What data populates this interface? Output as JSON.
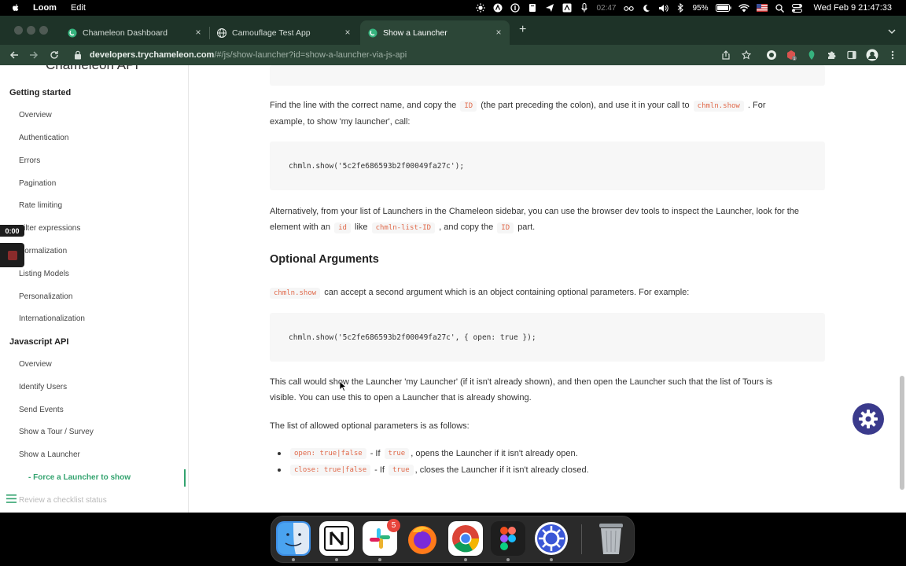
{
  "menubar": {
    "app_name": "Loom",
    "menu_edit": "Edit",
    "timer": "02:47",
    "battery": "95%",
    "clock": "Wed Feb 9  21:47:33"
  },
  "tabs": [
    {
      "label": "Chameleon Dashboard"
    },
    {
      "label": "Camouflage Test App"
    },
    {
      "label": "Show a Launcher"
    }
  ],
  "url": {
    "domain": "developers.trychameleon.com",
    "path": "/#/js/show-launcher?id=show-a-launcher-via-js-api"
  },
  "sidebar": {
    "brand": "Chameleon API",
    "section_getting_started": "Getting started",
    "getting_started_items": [
      "Overview",
      "Authentication",
      "Errors",
      "Pagination",
      "Rate limiting",
      "Filter expressions",
      "Normalization",
      "Listing Models",
      "Personalization",
      "Internationalization"
    ],
    "section_js": "Javascript API",
    "js_items": [
      "Overview",
      "Identify Users",
      "Send Events",
      "Show a Tour / Survey",
      "Show a Launcher"
    ],
    "sub_item": "- Force a Launcher to show",
    "faded_item": "Review a checklist status"
  },
  "loom": {
    "timer": "0:00"
  },
  "content": {
    "p1_a": "Find the line with the correct name, and copy the",
    "p1_code1": "ID",
    "p1_b": "(the part preceding the colon), and use it in your call to",
    "p1_code2": "chmln.show",
    "p1_c": ". For",
    "p1_line2": "example, to show 'my launcher', call:",
    "code1": "chmln.show('5c2fe686593b2f00049fa27c');",
    "p2_a": "Alternatively, from your list of Launchers in the Chameleon sidebar, you can use the browser dev tools to inspect the Launcher, look for the",
    "p2_b": "element with an",
    "p2_code1": "id",
    "p2_c": "like",
    "p2_code2": "chmln-list-ID",
    "p2_d": ", and copy the",
    "p2_code3": "ID",
    "p2_e": "part.",
    "h_optional": "Optional Arguments",
    "p3_code": "chmln.show",
    "p3_text": "can accept a second argument which is an object containing optional parameters. For example:",
    "code2": "chmln.show('5c2fe686593b2f00049fa27c', { open: true });",
    "p4_line1": "This call would show the Launcher 'my Launcher' (if it isn't already shown), and then open the Launcher such that the list of Tours is",
    "p4_line2": "visible. You can use this to open a Launcher that is already showing.",
    "p5": "The list of allowed optional parameters is as follows:",
    "bullets": [
      {
        "code": "open: true|false",
        "text1": "- If",
        "code2": "true",
        "text2": ", opens the Launcher if it isn't already open."
      },
      {
        "code": "close: true|false",
        "text1": "- If",
        "code2": "true",
        "text2": ", closes the Launcher if it isn't already closed."
      }
    ]
  },
  "dock": {
    "slack_badge": "5"
  },
  "colors": {
    "accent": "#33a36f",
    "code": "#e0694a",
    "chrome": "#2c4637"
  }
}
